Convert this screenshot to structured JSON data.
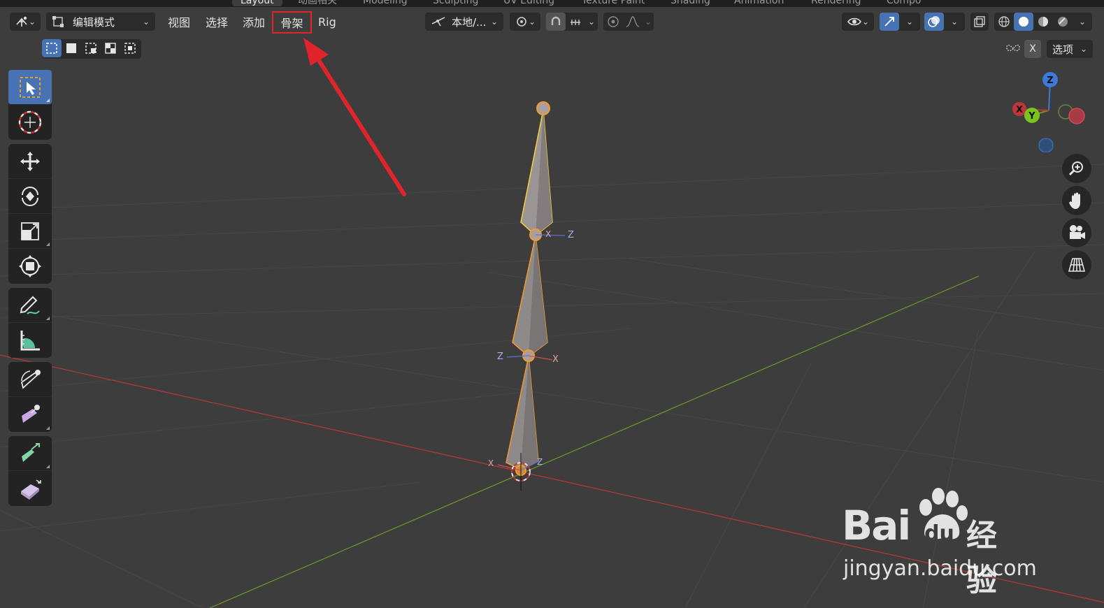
{
  "workspace_tabs": [
    "Layout",
    "动画相关",
    "Modeling",
    "Sculpting",
    "UV Editing",
    "Texture Paint",
    "Shading",
    "Animation",
    "Rendering",
    "Compo"
  ],
  "header": {
    "mode_label": "编辑模式",
    "menus": [
      "视图",
      "选择",
      "添加",
      "骨架",
      "Rig"
    ],
    "highlighted_menu": "骨架",
    "transform_orientation": "本地/...",
    "overlay_axis_label": "X",
    "options_label": "选项"
  },
  "viewport": {
    "bone_axis_labels": {
      "top_x": "X",
      "top_z": "Z",
      "mid_z": "Z",
      "mid_x": "X",
      "base_x": "X",
      "base_z": "Z"
    }
  },
  "gizmo": {
    "z": "Z",
    "y": "Y",
    "x": "X"
  },
  "watermark": {
    "brand": "Bai",
    "brand2": "du",
    "suffix": "经验",
    "url": "jingyan.baidu.com"
  },
  "colors": {
    "accent": "#4772b3",
    "highlight_box": "#e0242c",
    "arrow": "#e0242c",
    "bone_select": "#f59a2c",
    "bone_active": "#f5d23a",
    "x_axis": "#b8383a",
    "y_axis": "#6a9a2a"
  }
}
